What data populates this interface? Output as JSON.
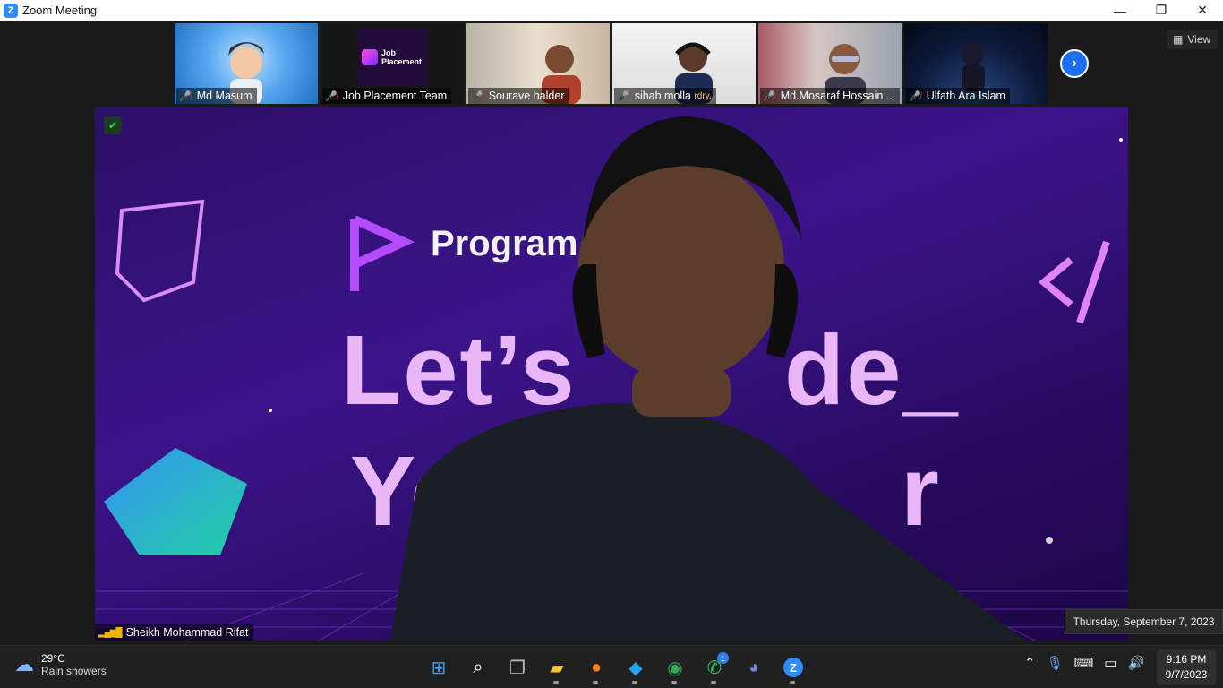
{
  "window": {
    "title": "Zoom Meeting",
    "logo_letter": "Z",
    "minimize": "—",
    "maximize": "❐",
    "close": "✕"
  },
  "view_button": {
    "label": "View"
  },
  "participants": [
    {
      "name": "Md Masum",
      "muted": true
    },
    {
      "name": "Job Placement Team",
      "muted": true,
      "logo_text": "Job Placement"
    },
    {
      "name": "Sourave halder",
      "muted": true
    },
    {
      "name": "sihab molla",
      "muted": true,
      "overlay_text": "rdry."
    },
    {
      "name": "Md.Mosaraf Hossain ...",
      "muted": true
    },
    {
      "name": "Ulfath Ara Islam",
      "muted": true
    }
  ],
  "next_page_icon": "chevron-right-icon",
  "main_speaker": {
    "name": "Sheikh Mohammad Rifat",
    "slide_brand": "Program",
    "slide_line1": "Let’s",
    "slide_line1b": "de_",
    "slide_line2": "Yo",
    "slide_line2b": "r"
  },
  "tooltip": {
    "text": "Thursday, September 7, 2023"
  },
  "taskbar": {
    "weather": {
      "temp": "29°C",
      "condition": "Rain showers"
    },
    "apps": [
      "windows-start",
      "search",
      "task-view",
      "file-explorer",
      "firefox",
      "vscode",
      "chrome",
      "whatsapp",
      "discord",
      "zoom"
    ],
    "whatsapp_badge": "1",
    "clock": {
      "time": "9:16 PM",
      "date": "9/7/2023"
    }
  },
  "colors": {
    "accent": "#2d8cff",
    "mute": "#e02828",
    "slide_bg": "#2a0f66",
    "slide_text": "#e9b7f7"
  }
}
